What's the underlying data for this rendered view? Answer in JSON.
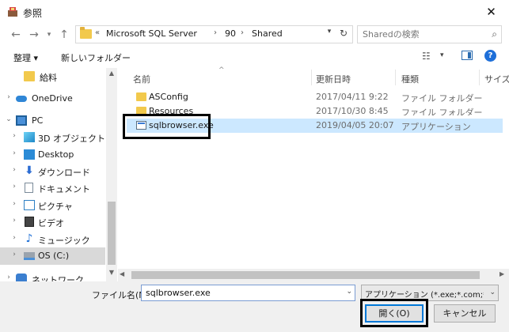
{
  "window": {
    "title": "参照",
    "close_glyph": "✕"
  },
  "address": {
    "overflow": "«",
    "crumbs": [
      "Microsoft SQL Server",
      "90",
      "Shared"
    ],
    "sep": "›",
    "search_placeholder": "Sharedの検索"
  },
  "toolbar": {
    "organize": "整理 ▾",
    "new_folder": "新しいフォルダー"
  },
  "nav": {
    "items": [
      {
        "label": "給料",
        "icon": "folder-icon"
      },
      {
        "label": "OneDrive",
        "icon": "cloud-icon"
      },
      {
        "label": "PC",
        "icon": "pc-icon"
      },
      {
        "label": "3D オブジェクト",
        "icon": "3d-objects-icon"
      },
      {
        "label": "Desktop",
        "icon": "desktop-icon"
      },
      {
        "label": "ダウンロード",
        "icon": "download-icon"
      },
      {
        "label": "ドキュメント",
        "icon": "documents-icon"
      },
      {
        "label": "ピクチャ",
        "icon": "pictures-icon"
      },
      {
        "label": "ビデオ",
        "icon": "videos-icon"
      },
      {
        "label": "ミュージック",
        "icon": "music-icon"
      },
      {
        "label": "OS (C:)",
        "icon": "drive-icon"
      },
      {
        "label": "ネットワーク",
        "icon": "network-icon"
      }
    ]
  },
  "columns": {
    "name": "名前",
    "date": "更新日時",
    "type": "種類",
    "size": "サイズ"
  },
  "files": [
    {
      "name": "ASConfig",
      "date": "2017/04/11 9:22",
      "type": "ファイル フォルダー"
    },
    {
      "name": "Resources",
      "date": "2017/10/30 8:45",
      "type": "ファイル フォルダー"
    },
    {
      "name": "sqlbrowser.exe",
      "date": "2019/04/05 20:07",
      "type": "アプリケーション"
    }
  ],
  "footer": {
    "filename_label": "ファイル名(N):",
    "filename_value": "sqlbrowser.exe",
    "filetype": "アプリケーション (*.exe;*.com;*.icd",
    "open": "開く(O)",
    "cancel": "キャンセル"
  }
}
